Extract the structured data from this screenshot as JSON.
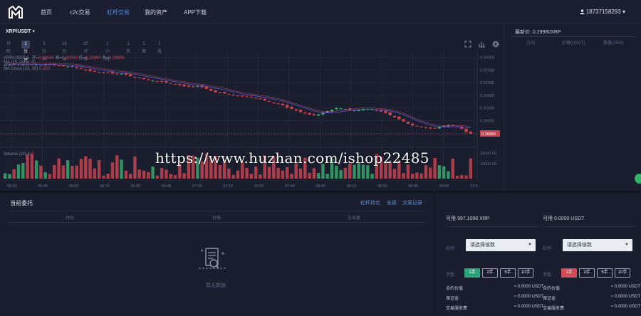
{
  "nav": {
    "items": [
      {
        "label": "首页",
        "active": false
      },
      {
        "label": "c2c交易",
        "active": false
      },
      {
        "label": "杠杆交易",
        "active": true
      },
      {
        "label": "我的资产",
        "active": false
      },
      {
        "label": "APP下载",
        "active": false
      }
    ],
    "user": "18737158293 ▾"
  },
  "chart": {
    "pair": "XRP/USDT ▾",
    "intervals": [
      "分时",
      "1分钟",
      "5分钟",
      "15分钟",
      "30分钟",
      "1小时",
      "1天",
      "1周",
      "1月"
    ],
    "active_interval": "1分钟",
    "legend_symbol": "XRP/USDT, 1",
    "ohlc": {
      "open_label": "开=",
      "open": "0.30040",
      "high_label": "高=",
      "high": "0.30040",
      "low_label": "低=",
      "low": "0.29990",
      "close_label": "收=",
      "close": "0.29990"
    },
    "ma_label": "MA (15, close, 0)",
    "ma_cross_label": "MA Cross (10, 30)",
    "ma_cross_values": "0.300",
    "volume_label": "Volume (20)",
    "volume_value": "6.0",
    "last_price": "0.29980",
    "y_ticks": [
      "0.33000",
      "0.32500",
      "0.32000",
      "0.31500",
      "0.31000",
      "0.30500",
      "0.30000"
    ],
    "volume_ticks": [
      "20000.00",
      "10000.00"
    ],
    "x_ticks": [
      "05:30",
      "05:45",
      "06:00",
      "06:15",
      "06:30",
      "06:45",
      "07:00",
      "07:15",
      "07:30",
      "07:45",
      "08:00",
      "08:15",
      "08:30",
      "08:45",
      "09:00",
      "12:0"
    ],
    "colors": {
      "up": "#3aa86b",
      "down": "#c7434f",
      "ma": "#6a5cd6",
      "ma2": "#c74f5c",
      "bg": "#1a1e2f"
    }
  },
  "chart_data": {
    "type": "candlestick",
    "title": "XRP/USDT, 1",
    "ylim": [
      0.297,
      0.331
    ],
    "price_close_trend": [
      0.327,
      0.3272,
      0.327,
      0.3272,
      0.3271,
      0.327,
      0.3272,
      0.3273,
      0.327,
      0.3271,
      0.3272,
      0.327,
      0.3268,
      0.3265,
      0.3264,
      0.3262,
      0.3258,
      0.3254,
      0.325,
      0.3246,
      0.3243,
      0.324,
      0.3241,
      0.3239,
      0.3236,
      0.3234,
      0.3236,
      0.3231,
      0.3225,
      0.3222,
      0.3219,
      0.3214,
      0.321,
      0.3208,
      0.3205,
      0.3203,
      0.32,
      0.3198,
      0.3194,
      0.319,
      0.3186,
      0.3184,
      0.3185,
      0.3187,
      0.3182,
      0.3175,
      0.3168,
      0.3162,
      0.316,
      0.3157,
      0.3155,
      0.315,
      0.3148,
      0.3146,
      0.3144,
      0.3142,
      0.3138,
      0.3135,
      0.313,
      0.3125,
      0.3121,
      0.3118,
      0.3111,
      0.3102,
      0.3097,
      0.309,
      0.3084,
      0.3079,
      0.3074,
      0.3071,
      0.3075,
      0.3082,
      0.3088,
      0.3093,
      0.31,
      0.3098,
      0.3095,
      0.3092,
      0.309,
      0.3093,
      0.3096,
      0.3097,
      0.3095,
      0.309,
      0.3086,
      0.308,
      0.3071,
      0.3063,
      0.3055,
      0.3047,
      0.3038,
      0.3031,
      0.3028,
      0.3025,
      0.3022,
      0.302,
      0.3021,
      0.3025,
      0.3029,
      0.3032,
      0.303,
      0.3026,
      0.3018,
      0.3005,
      0.2999
    ]
  },
  "book": {
    "latest_price": "最新价: 0.29980XRP",
    "headers": [
      "方向",
      "价格(USDT)",
      "数量(XRP)"
    ]
  },
  "orders": {
    "title": "当前委托",
    "links": [
      "杠杆持仓",
      "全部",
      "交易记录"
    ],
    "columns": [
      "时间",
      "价格",
      "交易量"
    ],
    "empty": "暂无数据"
  },
  "trade": {
    "buy": {
      "available": "可用 997.1098 XRP",
      "leverage_label": "杠杆:",
      "select_placeholder": "请选择倍数",
      "hands_label": "手数:",
      "hands": [
        "1手",
        "3手",
        "5手",
        "10手"
      ],
      "rows": [
        {
          "k": "合约价值",
          "v": "≈ 0.0000 USDT"
        },
        {
          "k": "保证金",
          "v": "≈ 0.0000 USDT"
        },
        {
          "k": "交易服务费",
          "v": "≈ 0.0000 USDT"
        }
      ]
    },
    "sell": {
      "available": "可用 0.0000 USDT",
      "leverage_label": "杠杆:",
      "select_placeholder": "请选择倍数",
      "hands_label": "手数:",
      "hands": [
        "1手",
        "3手",
        "5手",
        "10手"
      ],
      "rows": [
        {
          "k": "合约价值",
          "v": "≈ 0.0000 USDT"
        },
        {
          "k": "保证金",
          "v": "≈ 0.0000 USDT"
        },
        {
          "k": "交易服务费",
          "v": "≈ 0.0000 USDT"
        }
      ]
    }
  },
  "watermark": "https://www.huzhan.com/ishop22485"
}
